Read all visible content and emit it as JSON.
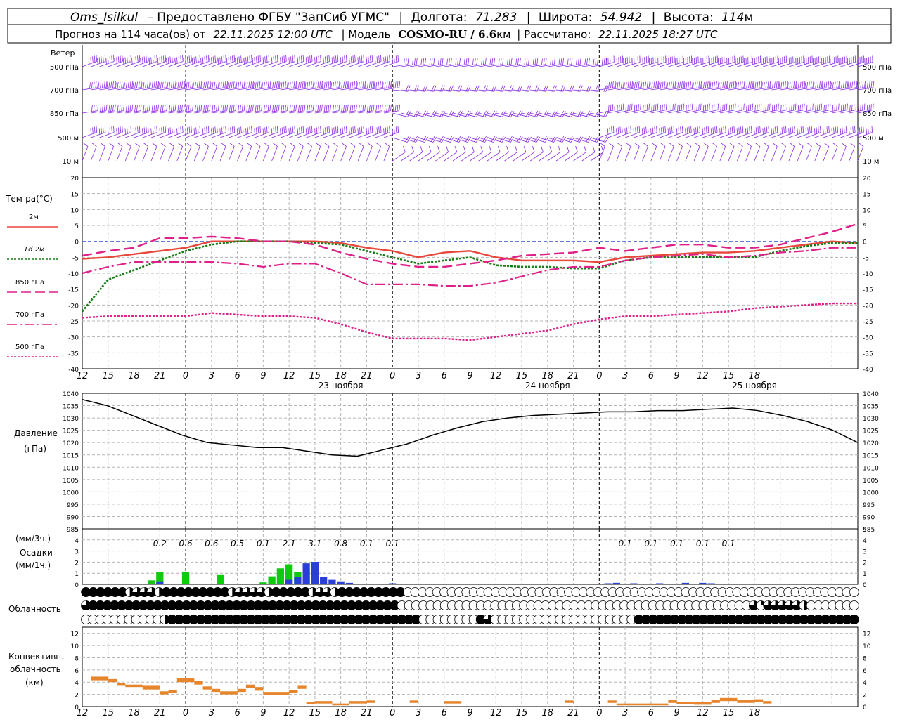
{
  "header": {
    "line1": {
      "station": "Oms_Isilkul",
      "provider": "– Предоставлено ФГБУ \"ЗапСиб УГМС\"",
      "lon_label": "Долгота:",
      "lon": "71.283",
      "lat_label": "Широта:",
      "lat": "54.942",
      "alt_label": "Высота:",
      "alt": "114",
      "alt_unit": "м"
    },
    "line2": {
      "forecast_label": "Прогноз на 114 часа(ов) от",
      "forecast_from": "22.11.2025 12:00 UTC",
      "model_label": "| Модель",
      "model": "COSMO-RU / 6.6",
      "model_unit": "км",
      "calc_label": "| Рассчитано:",
      "calc_time": "22.11.2025 18:27 UTC"
    }
  },
  "time_axis": {
    "hour_labels": [
      "12",
      "15",
      "18",
      "21",
      "0",
      "3",
      "6",
      "9",
      "12",
      "15",
      "18",
      "21",
      "0",
      "3",
      "6",
      "9",
      "12",
      "15",
      "18",
      "21",
      "0",
      "3",
      "6",
      "9",
      "12",
      "15",
      "18"
    ],
    "day_labels": [
      {
        "text": "23 ноября",
        "hour": 30
      },
      {
        "text": "24 ноября",
        "hour": 54
      },
      {
        "text": "25 ноября",
        "hour": 78
      }
    ]
  },
  "chart_data": [
    {
      "type": "line",
      "panel": "wind",
      "title": "Ветер",
      "levels": [
        "500 гПа",
        "700 гПа",
        "850 гПа",
        "500 м",
        "10  м"
      ],
      "right_levels": [
        "500 гПа",
        "700 гПа",
        "850 гПа",
        "500 м",
        "10  м"
      ],
      "color": "#8a2be2"
    },
    {
      "type": "line",
      "panel": "temperature",
      "ylabel": "Тем-ра(°C)",
      "ylim": [
        -40,
        20
      ],
      "yticks": [
        20,
        15,
        10,
        5,
        0,
        -5,
        -10,
        -15,
        -20,
        -25,
        -30,
        -35,
        -40
      ],
      "x": [
        0,
        3,
        6,
        9,
        12,
        15,
        18,
        21,
        24,
        27,
        30,
        33,
        36,
        39,
        42,
        45,
        48,
        51,
        54,
        57,
        60,
        63,
        66,
        69,
        72,
        75,
        78,
        81,
        84,
        87,
        90
      ],
      "series": [
        {
          "name": "2м",
          "color": "#e8473c",
          "dash": "none",
          "width": 2.4,
          "values": [
            -5.5,
            -5,
            -4,
            -3,
            -2,
            0,
            0,
            0,
            0,
            0,
            -0.5,
            -2,
            -3,
            -5,
            -3.5,
            -3,
            -5,
            -6,
            -6,
            -6,
            -6.5,
            -5,
            -4.5,
            -4,
            -3.5,
            -3.5,
            -3,
            -2,
            -1,
            0,
            -0.5
          ]
        },
        {
          "name": "Td  2м",
          "color": "#137c13",
          "dash": "3,2",
          "width": 2.6,
          "values": [
            -22,
            -12,
            -9,
            -6,
            -3,
            -1,
            0,
            0,
            0,
            -0.5,
            -1,
            -3,
            -5,
            -7,
            -6,
            -5,
            -7.5,
            -8,
            -8,
            -8.5,
            -8.5,
            -6,
            -5,
            -5,
            -5,
            -5,
            -5,
            -3,
            -1.5,
            -0.5,
            -0.5
          ]
        },
        {
          "name": "850 гПа",
          "color": "#e0208a",
          "dash": "14,6",
          "width": 2.4,
          "values": [
            -4.5,
            -3,
            -2,
            1,
            1,
            1.5,
            1,
            0,
            0,
            -1,
            -3.5,
            -5.5,
            -7,
            -8,
            -8,
            -7,
            -6,
            -4.5,
            -4,
            -3.5,
            -2,
            -3,
            -2,
            -1,
            -1,
            -2,
            -2,
            -1,
            1,
            3,
            5.5
          ]
        },
        {
          "name": "700 гПа",
          "color": "#e0208a",
          "dash": "14,4,3,4",
          "width": 2.2,
          "values": [
            -10,
            -8,
            -6.5,
            -6.5,
            -6.5,
            -6.5,
            -7,
            -8,
            -7,
            -7,
            -10,
            -13.5,
            -13.5,
            -13.5,
            -14,
            -14,
            -13,
            -11,
            -9,
            -8,
            -8,
            -6,
            -5,
            -4.5,
            -4,
            -5,
            -4.5,
            -3.5,
            -3,
            -2,
            -2
          ]
        },
        {
          "name": "500 гПа",
          "color": "#e0208a",
          "dash": "3,2",
          "width": 2.4,
          "values": [
            -24,
            -23.5,
            -23.5,
            -23.5,
            -23.5,
            -22.5,
            -23,
            -23.5,
            -23.5,
            -24,
            -26,
            -28.5,
            -30.5,
            -30.5,
            -30.5,
            -31,
            -30,
            -29,
            -28,
            -26,
            -24.5,
            -23.5,
            -23.5,
            -23,
            -22.5,
            -22,
            -21,
            -20.5,
            -20,
            -19.5,
            -19.5
          ]
        }
      ],
      "zero_line_color": "#4a6ad0"
    },
    {
      "type": "line",
      "panel": "pressure",
      "ylabel": "Давление",
      "ylabel2": "(гПа)",
      "ylim": [
        985,
        1040
      ],
      "yticks": [
        1040,
        1035,
        1030,
        1025,
        1020,
        1015,
        1010,
        1005,
        1000,
        995,
        990,
        985
      ],
      "x": [
        0,
        3,
        6,
        9,
        12,
        15,
        18,
        21,
        24,
        27,
        30,
        33,
        36,
        39,
        42,
        45,
        48,
        51,
        54,
        57,
        60,
        63,
        66,
        69,
        72,
        75,
        78,
        81,
        84,
        87,
        90
      ],
      "series": [
        {
          "name": "",
          "color": "#000000",
          "values": [
            1037.5,
            1035,
            1031,
            1027,
            1023,
            1020,
            1019,
            1018,
            1018,
            1016.5,
            1015,
            1014.5,
            1017,
            1019.5,
            1023,
            1026,
            1028.5,
            1030,
            1031,
            1031.5,
            1032,
            1032.5,
            1032.5,
            1033,
            1033,
            1033.5,
            1034,
            1033,
            1031,
            1028.5,
            1025,
            1020
          ]
        }
      ]
    },
    {
      "type": "bar",
      "panel": "precipitation",
      "ylabel_lines": [
        "(мм/3ч.)",
        "Осадки",
        "(мм/1ч.)"
      ],
      "ylim": [
        0,
        5
      ],
      "yticks": [
        5,
        4,
        3,
        2,
        1,
        0
      ],
      "totals": [
        {
          "hour": 9,
          "text": "0.2"
        },
        {
          "hour": 12,
          "text": "0.6"
        },
        {
          "hour": 15,
          "text": "0.6"
        },
        {
          "hour": 18,
          "text": "0.5"
        },
        {
          "hour": 21,
          "text": "0.1"
        },
        {
          "hour": 24,
          "text": "2.1"
        },
        {
          "hour": 27,
          "text": "3.1"
        },
        {
          "hour": 30,
          "text": "0.8"
        },
        {
          "hour": 33,
          "text": "0.1"
        },
        {
          "hour": 36,
          "text": "0.1"
        },
        {
          "hour": 63,
          "text": "0.1"
        },
        {
          "hour": 66,
          "text": "0.1"
        },
        {
          "hour": 69,
          "text": "0.1"
        },
        {
          "hour": 72,
          "text": "0.1"
        },
        {
          "hour": 75,
          "text": "0.1"
        }
      ],
      "green_bars": [
        {
          "hour": 8,
          "value": 0.2
        },
        {
          "hour": 9,
          "value": 0.6
        },
        {
          "hour": 12,
          "value": 0.6
        },
        {
          "hour": 16,
          "value": 0.5
        },
        {
          "hour": 21,
          "value": 0.1
        },
        {
          "hour": 22,
          "value": 0.4
        },
        {
          "hour": 23,
          "value": 0.8
        },
        {
          "hour": 24,
          "value": 1.0
        },
        {
          "hour": 25,
          "value": 0.6
        }
      ],
      "blue_bars": [
        {
          "hour": 9,
          "value": 0.2
        },
        {
          "hour": 24,
          "value": 0.3
        },
        {
          "hour": 25,
          "value": 0.5
        },
        {
          "hour": 26,
          "value": 1.4
        },
        {
          "hour": 27,
          "value": 1.5
        },
        {
          "hour": 28,
          "value": 0.5
        },
        {
          "hour": 29,
          "value": 0.3
        },
        {
          "hour": 30,
          "value": 0.2
        },
        {
          "hour": 31,
          "value": 0.1
        },
        {
          "hour": 36,
          "value": 0.05
        },
        {
          "hour": 61,
          "value": 0.05
        },
        {
          "hour": 62,
          "value": 0.1
        },
        {
          "hour": 64,
          "value": 0.05
        },
        {
          "hour": 67,
          "value": 0.05
        },
        {
          "hour": 70,
          "value": 0.1
        },
        {
          "hour": 72,
          "value": 0.1
        },
        {
          "hour": 73,
          "value": 0.05
        }
      ],
      "green_color": "#0fca0f",
      "blue_color": "#2a3fd8"
    },
    {
      "type": "table",
      "panel": "cloudiness",
      "ylabel": "Облачность",
      "rows": [
        "FFFFFFHTTTHFFFFFFFFFHTTTTHFFFFFHTTHFFFFFFFFFEEEEEEEEEEEEEEEEEEEEEEEEEEEEEEEEEEEEEEEEEEEEEEEEEEEEEEEEEEEEEE",
        "TFFFFFFFFFFFFFFFFFFFFFFFFFFFFFFFFFFFFFFFFFFFEEEEEEEEEEEEEEEEEEEEEEEEEEEEEEEEEEEEEEEEEEEEEEEEETQTTTTTHEEEEEEE",
        "EEEEEEEEEEEHFFFFFFFFFFFFFFFFFFFFFFFFFFFFFFFFFFFEEEEEEEEFTEEEEEEEEEEEEEEEEEEEEFFFFFFFFFFFFFFFFFFFFFFFFFFFFFFF"
      ],
      "legend": {
        "F": "overcast",
        "E": "clear",
        "H": "half",
        "T": "three-quarters",
        "Q": "quarter"
      }
    },
    {
      "type": "bar",
      "panel": "convective",
      "ylabel_lines": [
        "Конвективн.",
        "облачность",
        "(км)"
      ],
      "ylim": [
        0,
        13
      ],
      "yticks": [
        12,
        10,
        8,
        6,
        4,
        2,
        0
      ],
      "bars_color": "#e6852c",
      "segments": [
        {
          "h0": 1,
          "h1": 3,
          "bottom": 4.3,
          "top": 4.9
        },
        {
          "h0": 3,
          "h1": 4,
          "bottom": 4.0,
          "top": 4.5
        },
        {
          "h0": 4,
          "h1": 5,
          "bottom": 3.4,
          "top": 3.9
        },
        {
          "h0": 5,
          "h1": 7,
          "bottom": 3.2,
          "top": 3.6
        },
        {
          "h0": 7,
          "h1": 9,
          "bottom": 2.8,
          "top": 3.4
        },
        {
          "h0": 9,
          "h1": 10,
          "bottom": 2.0,
          "top": 2.5
        },
        {
          "h0": 10,
          "h1": 11,
          "bottom": 2.2,
          "top": 2.7
        },
        {
          "h0": 11,
          "h1": 13,
          "bottom": 4.0,
          "top": 4.6
        },
        {
          "h0": 13,
          "h1": 14,
          "bottom": 3.6,
          "top": 4.2
        },
        {
          "h0": 14,
          "h1": 15,
          "bottom": 2.8,
          "top": 3.3
        },
        {
          "h0": 15,
          "h1": 16,
          "bottom": 2.4,
          "top": 2.9
        },
        {
          "h0": 16,
          "h1": 18,
          "bottom": 2.0,
          "top": 2.5
        },
        {
          "h0": 18,
          "h1": 19,
          "bottom": 2.4,
          "top": 2.9
        },
        {
          "h0": 19,
          "h1": 20,
          "bottom": 3.0,
          "top": 3.6
        },
        {
          "h0": 20,
          "h1": 21,
          "bottom": 2.6,
          "top": 3.2
        },
        {
          "h0": 21,
          "h1": 24,
          "bottom": 1.9,
          "top": 2.4
        },
        {
          "h0": 24,
          "h1": 25,
          "bottom": 2.2,
          "top": 2.7
        },
        {
          "h0": 25,
          "h1": 26,
          "bottom": 2.9,
          "top": 3.4
        },
        {
          "h0": 26,
          "h1": 27,
          "bottom": 0.4,
          "top": 0.8
        },
        {
          "h0": 27,
          "h1": 29,
          "bottom": 0.5,
          "top": 0.9
        },
        {
          "h0": 29,
          "h1": 31,
          "bottom": 0.2,
          "top": 0.5
        },
        {
          "h0": 31,
          "h1": 33,
          "bottom": 0.5,
          "top": 0.9
        },
        {
          "h0": 33,
          "h1": 34,
          "bottom": 0.6,
          "top": 1.0
        },
        {
          "h0": 38,
          "h1": 39,
          "bottom": 0.6,
          "top": 1.0
        },
        {
          "h0": 42,
          "h1": 44,
          "bottom": 0.5,
          "top": 0.9
        },
        {
          "h0": 56,
          "h1": 57,
          "bottom": 0.6,
          "top": 1.0
        },
        {
          "h0": 61,
          "h1": 62,
          "bottom": 0.6,
          "top": 1.0
        },
        {
          "h0": 62,
          "h1": 68,
          "bottom": 0.2,
          "top": 0.5
        },
        {
          "h0": 68,
          "h1": 69,
          "bottom": 0.6,
          "top": 1.1
        },
        {
          "h0": 69,
          "h1": 71,
          "bottom": 0.4,
          "top": 0.8
        },
        {
          "h0": 71,
          "h1": 73,
          "bottom": 0.3,
          "top": 0.7
        },
        {
          "h0": 73,
          "h1": 74,
          "bottom": 0.6,
          "top": 1.1
        },
        {
          "h0": 74,
          "h1": 76,
          "bottom": 0.9,
          "top": 1.4
        },
        {
          "h0": 76,
          "h1": 78,
          "bottom": 0.6,
          "top": 1.1
        },
        {
          "h0": 78,
          "h1": 79,
          "bottom": 0.8,
          "top": 1.2
        },
        {
          "h0": 79,
          "h1": 80,
          "bottom": 0.5,
          "top": 0.9
        }
      ]
    }
  ]
}
